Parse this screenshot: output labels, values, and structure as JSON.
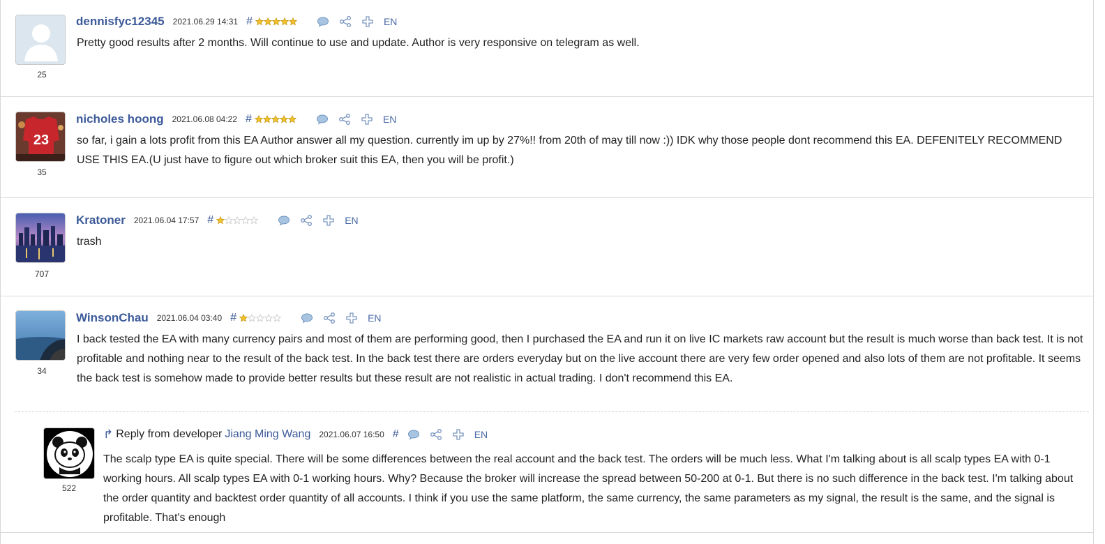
{
  "reviews": [
    {
      "username": "dennisfyc12345",
      "date": "2021.06.29 14:31",
      "hash": "#",
      "rating": 5,
      "lang": "EN",
      "reputation": "25",
      "text": "Pretty good results after 2 months. Will continue to use and update. Author is very responsive on telegram as well."
    },
    {
      "username": "nicholes hoong",
      "date": "2021.06.08 04:22",
      "hash": "#",
      "rating": 5,
      "lang": "EN",
      "reputation": "35",
      "text": "so far, i gain a lots profit from this EA Author answer all my question. currently im up by 27%!! from 20th of may till now :)) IDK why those people dont recommend this EA. DEFENITELY RECOMMEND USE THIS EA.(U just have to figure out which broker suit this EA, then you will be profit.)"
    },
    {
      "username": "Kratoner",
      "date": "2021.06.04 17:57",
      "hash": "#",
      "rating": 1,
      "lang": "EN",
      "reputation": "707",
      "text": "trash"
    },
    {
      "username": "WinsonChau",
      "date": "2021.06.04 03:40",
      "hash": "#",
      "rating": 1,
      "lang": "EN",
      "reputation": "34",
      "text": "I back tested the EA with many currency pairs and most of them are performing good, then I purchased the EA and run it on live IC markets raw account but the result is much worse than back test. It is not profitable and nothing near to the result of the back test. In the back test there are orders everyday but on the live account there are very few order opened and also lots of them are not profitable. It seems the back test is somehow made to provide better results but these result are not realistic in actual trading. I don't recommend this EA."
    }
  ],
  "reply": {
    "prefix": "Reply from developer",
    "developer": "Jiang Ming Wang",
    "date": "2021.06.07 16:50",
    "hash": "#",
    "lang": "EN",
    "reputation": "522",
    "text": "The scalp type EA is quite special. There will be some differences between the real account and the back test. The orders will be much less. What I'm talking about is all scalp types EA with 0-1 working hours. All scalp types EA with 0-1 working hours. Why? Because the broker will increase the spread between 50-200 at 0-1. But there is no such difference in the back test. I'm talking about the order quantity and backtest order quantity of all accounts. I think if you use the same platform, the same currency, the same parameters as my signal, the result is the same, and the signal is profitable. That's enough"
  },
  "colors": {
    "link": "#3c5a99",
    "star_filled": "#f2c230",
    "star_empty": "#c9c9c9"
  },
  "icons": [
    "comment-icon",
    "share-icon",
    "plus-icon"
  ]
}
